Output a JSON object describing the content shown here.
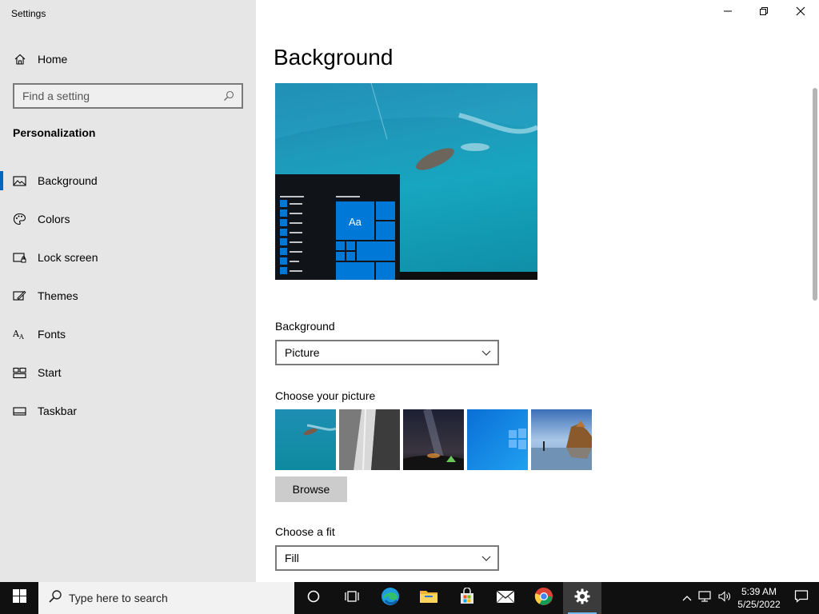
{
  "window": {
    "title": "Settings"
  },
  "sidebar": {
    "home_label": "Home",
    "search_placeholder": "Find a setting",
    "section_title": "Personalization",
    "items": [
      {
        "label": "Background",
        "icon": "picture-icon",
        "selected": true
      },
      {
        "label": "Colors",
        "icon": "palette-icon"
      },
      {
        "label": "Lock screen",
        "icon": "lock-screen-icon"
      },
      {
        "label": "Themes",
        "icon": "themes-icon"
      },
      {
        "label": "Fonts",
        "icon": "fonts-icon"
      },
      {
        "label": "Start",
        "icon": "start-icon"
      },
      {
        "label": "Taskbar",
        "icon": "taskbar-icon"
      }
    ]
  },
  "main": {
    "page_title": "Background",
    "preview_tile_text": "Aa",
    "background_label": "Background",
    "background_value": "Picture",
    "choose_picture_label": "Choose your picture",
    "browse_label": "Browse",
    "fit_label": "Choose a fit",
    "fit_value": "Fill"
  },
  "taskbar": {
    "search_text": "Type here to search",
    "time": "5:39 AM",
    "date": "5/25/2022"
  },
  "colors": {
    "accent": "#0067c0",
    "tile_blue": "#0078d7",
    "sidebar_bg": "#e6e6e6",
    "taskbar_bg": "#101010"
  }
}
